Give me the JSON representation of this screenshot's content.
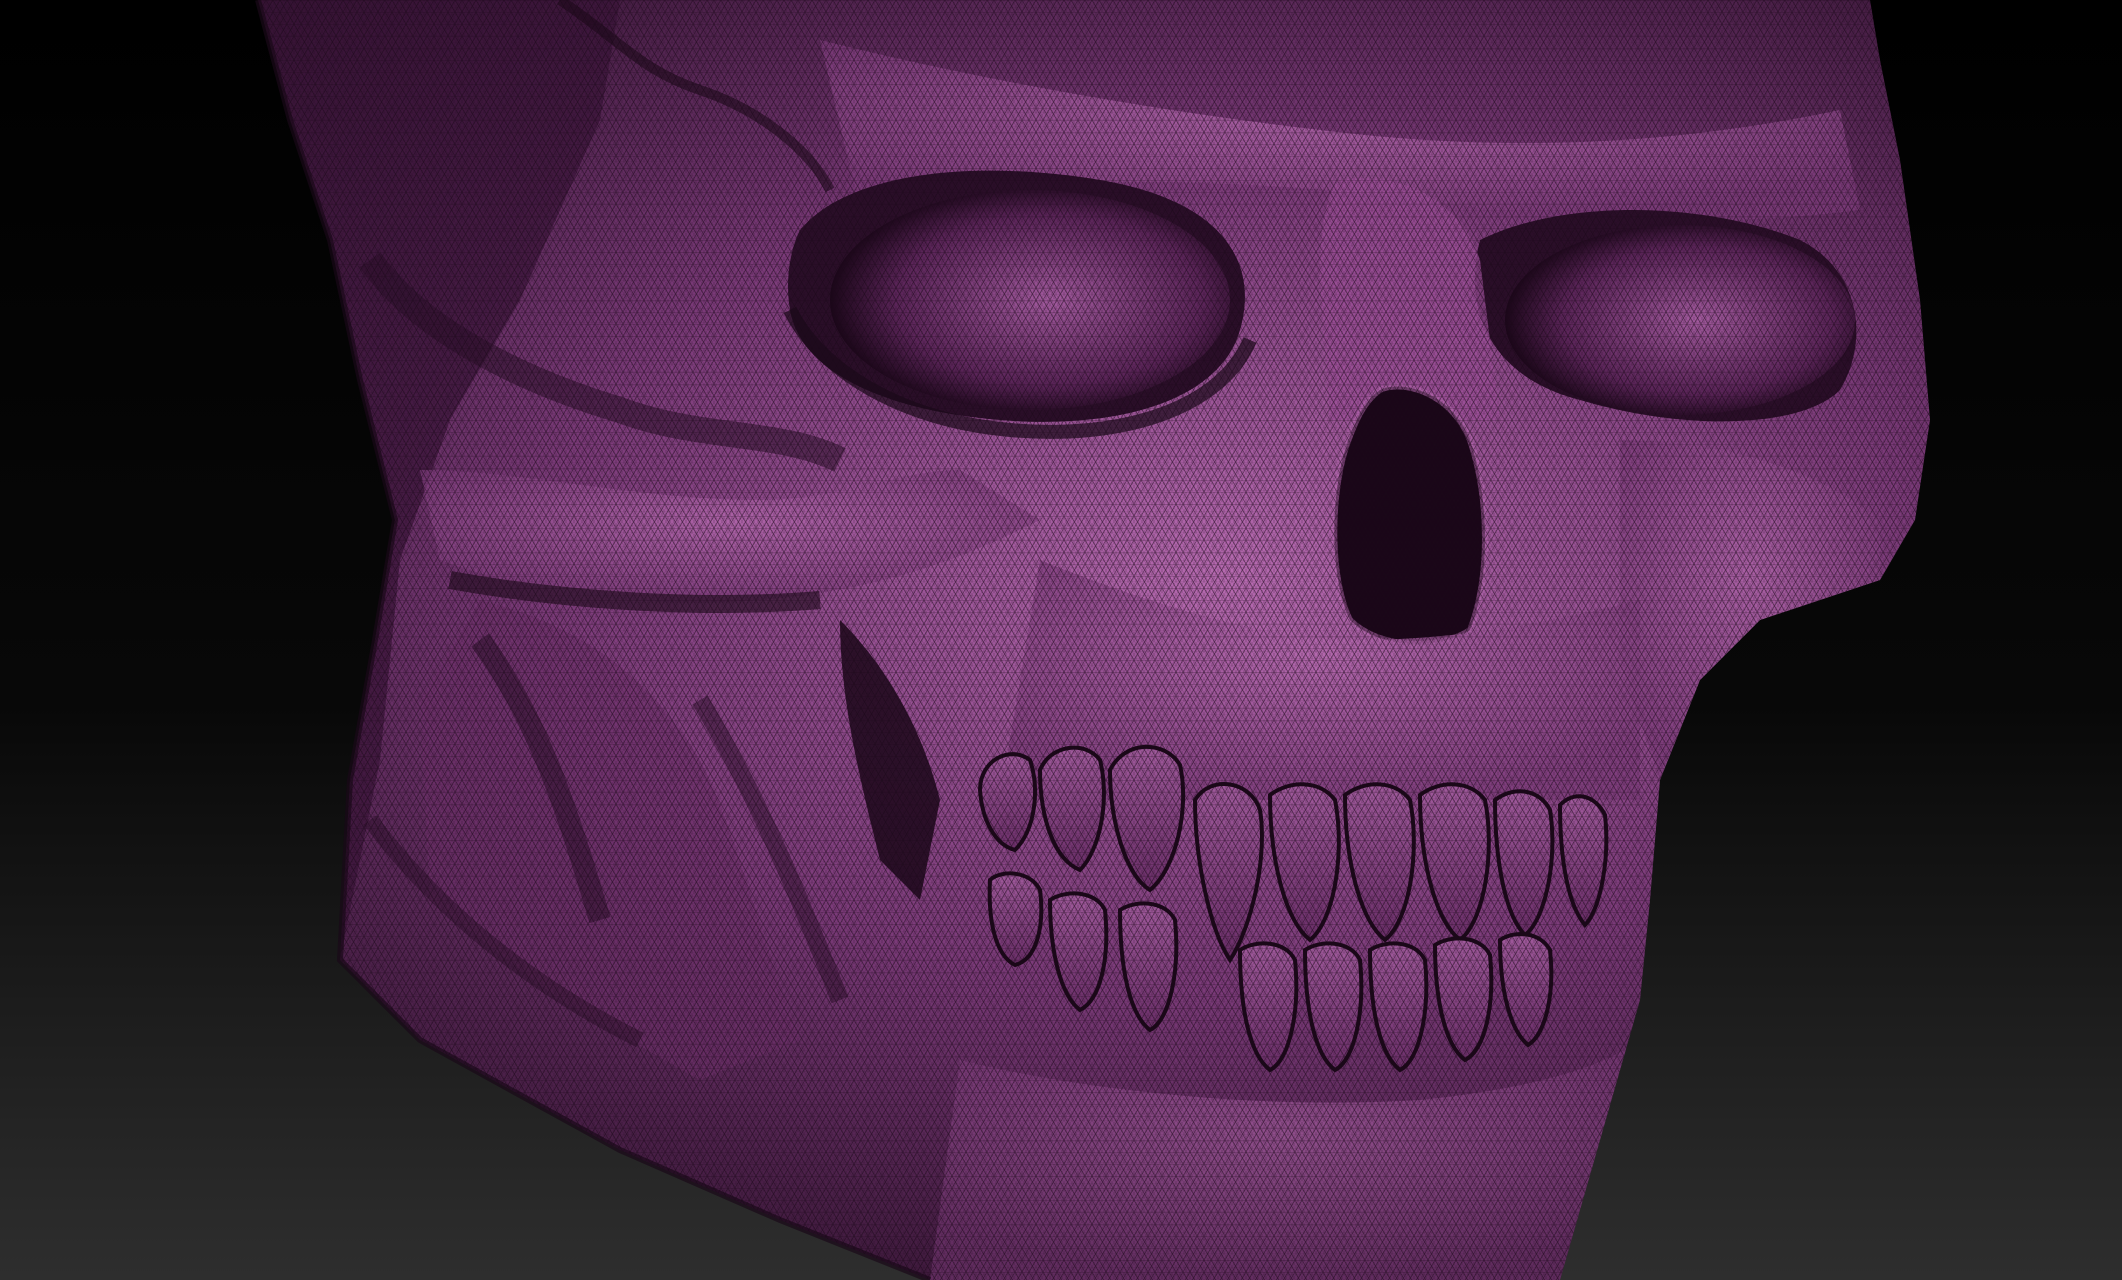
{
  "viewport": {
    "background_top": "#000000",
    "background_bottom": "#2e2e2e"
  },
  "model": {
    "subject": "skull-sculpt",
    "material_base": "#7a3a78",
    "material_highlight": "#b66ab0",
    "material_shadow": "#2a0e28",
    "wireframe_color": "#1a0818",
    "wireframe_visible": true
  }
}
